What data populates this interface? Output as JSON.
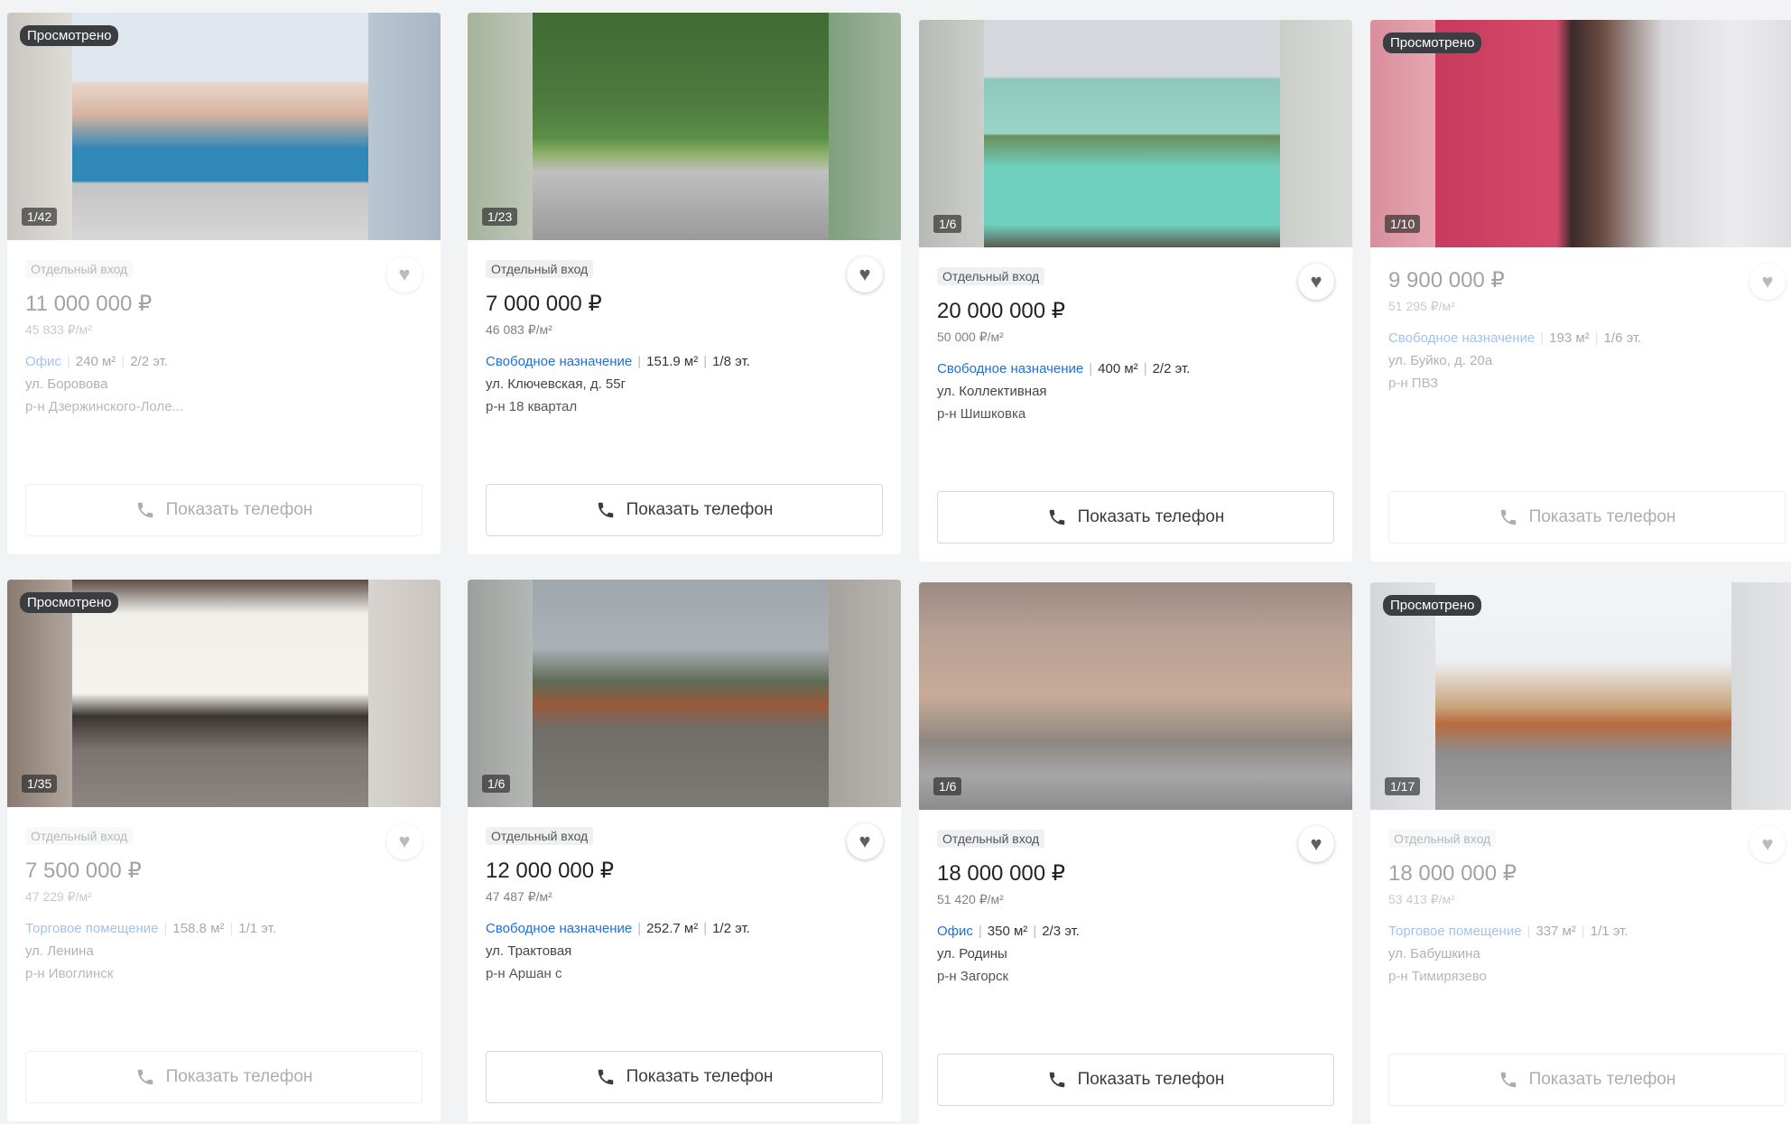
{
  "viewed_label": "Просмотрено",
  "phone_label": "Показать телефон",
  "colors": {
    "accent": "#1f6fd6",
    "badge": "#3b3d40"
  },
  "cards": [
    {
      "viewed": true,
      "counter": "1/42",
      "tag": "Отдельный вход",
      "price": "11 000 000 ₽",
      "ppm": "45 833 ₽/м²",
      "kind": "Офис",
      "area": "240 м²",
      "floor": "2/2 эт.",
      "address": "ул. Боровова",
      "district": "р-н Дзержинского-Лоле..."
    },
    {
      "viewed": false,
      "counter": "1/23",
      "tag": "Отдельный вход",
      "price": "7 000 000 ₽",
      "ppm": "46 083 ₽/м²",
      "kind": "Свободное назначение",
      "area": "151.9 м²",
      "floor": "1/8 эт.",
      "address": "ул. Ключевская, д. 55г",
      "district": "р-н 18 квартал"
    },
    {
      "viewed": false,
      "counter": "1/6",
      "tag": "Отдельный вход",
      "price": "20 000 000 ₽",
      "ppm": "50 000 ₽/м²",
      "kind": "Свободное назначение",
      "area": "400 м²",
      "floor": "2/2 эт.",
      "address": "ул. Коллективная",
      "district": "р-н Шишковка"
    },
    {
      "viewed": true,
      "counter": "1/10",
      "tag": "",
      "price": "9 900 000 ₽",
      "ppm": "51 295 ₽/м²",
      "kind": "Свободное назначение",
      "area": "193 м²",
      "floor": "1/6 эт.",
      "address": "ул. Буйко, д. 20а",
      "district": "р-н ПВЗ"
    },
    {
      "viewed": true,
      "counter": "1/35",
      "tag": "Отдельный вход",
      "price": "7 500 000 ₽",
      "ppm": "47 229 ₽/м²",
      "kind": "Торговое помещение",
      "area": "158.8 м²",
      "floor": "1/1 эт.",
      "address": "ул. Ленина",
      "district": "р-н Ивоглинск"
    },
    {
      "viewed": false,
      "counter": "1/6",
      "tag": "Отдельный вход",
      "price": "12 000 000 ₽",
      "ppm": "47 487 ₽/м²",
      "kind": "Свободное назначение",
      "area": "252.7 м²",
      "floor": "1/2 эт.",
      "address": "ул. Трактовая",
      "district": "р-н Аршан с"
    },
    {
      "viewed": false,
      "counter": "1/6",
      "tag": "Отдельный вход",
      "price": "18 000 000 ₽",
      "ppm": "51 420 ₽/м²",
      "kind": "Офис",
      "area": "350 м²",
      "floor": "2/3 эт.",
      "address": "ул. Родины",
      "district": "р-н Загорск"
    },
    {
      "viewed": true,
      "counter": "1/17",
      "tag": "Отдельный вход",
      "price": "18 000 000 ₽",
      "ppm": "53 413 ₽/м²",
      "kind": "Торговое помещение",
      "area": "337 м²",
      "floor": "1/1 эт.",
      "address": "ул. Бабушкина",
      "district": "р-н Тимирязево"
    }
  ]
}
